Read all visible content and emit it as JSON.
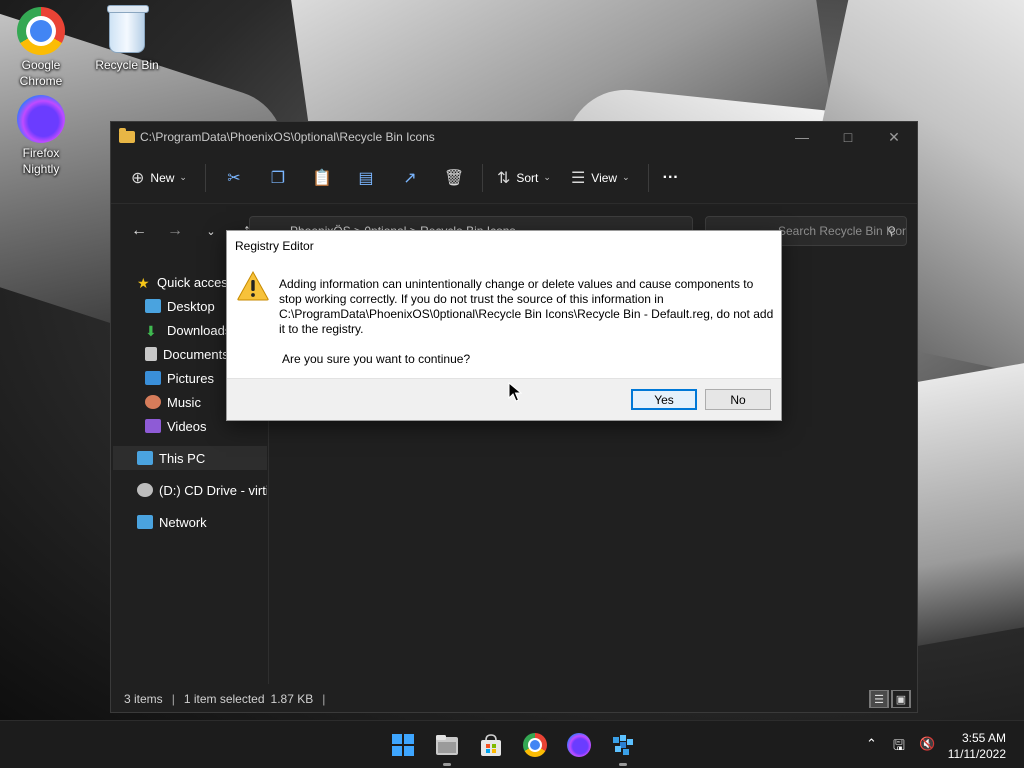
{
  "desktop": {
    "icons": [
      {
        "label": "Google\nChrome",
        "icon": "chrome-icon"
      },
      {
        "label": "Recycle Bin",
        "icon": "recycle-bin-icon"
      },
      {
        "label": "Firefox\nNightly",
        "icon": "firefox-nightly-icon"
      }
    ]
  },
  "explorer": {
    "title": "C:\\ProgramData\\PhoenixOS\\0ptional\\Recycle Bin Icons",
    "toolbar": {
      "new_label": "New",
      "sort_label": "Sort",
      "view_label": "View",
      "more_label": "···"
    },
    "address": "PhoenixÖS  >  0ptional  >  Recycle Bin Icons",
    "search_placeholder": "Search Recycle Bin Icons",
    "sidebar": [
      {
        "label": "Quick access",
        "icon": "star-icon"
      },
      {
        "label": "Desktop",
        "icon": "desktop-icon"
      },
      {
        "label": "Downloads",
        "icon": "download-icon"
      },
      {
        "label": "Documents",
        "icon": "document-icon"
      },
      {
        "label": "Pictures",
        "icon": "picture-icon"
      },
      {
        "label": "Music",
        "icon": "music-icon"
      },
      {
        "label": "Videos",
        "icon": "video-icon"
      },
      {
        "label": "This PC",
        "icon": "computer-icon"
      },
      {
        "label": "(D:) CD Drive - virtio-win",
        "icon": "cd-drive-icon"
      },
      {
        "label": "Network",
        "icon": "network-icon"
      }
    ],
    "status": {
      "items": "3 items",
      "selected": "1 item selected",
      "size": "1.87 KB"
    }
  },
  "dialog": {
    "title": "Registry Editor",
    "message": "Adding information can unintentionally change or delete values and cause components to stop working correctly. If you do not trust the source of this information in C:\\ProgramData\\PhoenixOS\\0ptional\\Recycle Bin Icons\\Recycle Bin - Default.reg, do not add it to the registry.",
    "question": "Are you sure you want to continue?",
    "yes_label": "Yes",
    "no_label": "No"
  },
  "taskbar": {
    "apps": [
      "start-icon",
      "file-explorer-icon",
      "store-icon",
      "chrome-icon",
      "firefox-nightly-icon",
      "registry-editor-icon"
    ],
    "clock": {
      "time": "3:55 AM",
      "date": "11/11/2022"
    }
  },
  "colors": {
    "accent": "#0078d7",
    "explorer_bg": "#202020",
    "taskbar_bg": "#1c1c1c"
  }
}
